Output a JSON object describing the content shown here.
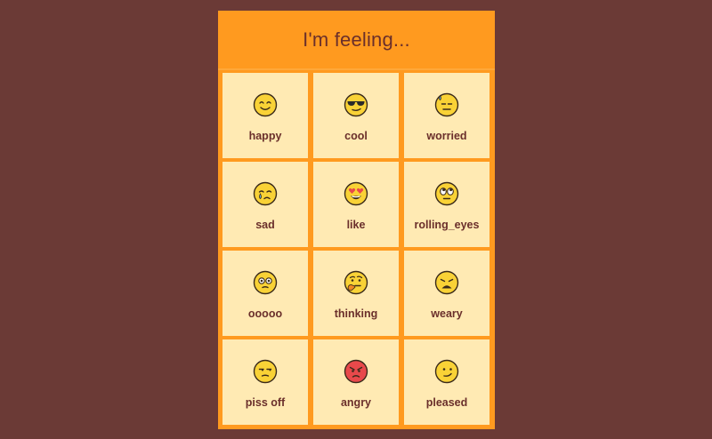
{
  "header": {
    "title": "I'm feeling..."
  },
  "moods": [
    {
      "label": "happy",
      "icon": "happy-face-icon"
    },
    {
      "label": "cool",
      "icon": "sunglasses-face-icon"
    },
    {
      "label": "worried",
      "icon": "sweat-face-icon"
    },
    {
      "label": "sad",
      "icon": "crying-face-icon"
    },
    {
      "label": "like",
      "icon": "heart-eyes-face-icon"
    },
    {
      "label": "rolling_eyes",
      "icon": "rolling-eyes-face-icon"
    },
    {
      "label": "ooooo",
      "icon": "dizzy-face-icon"
    },
    {
      "label": "thinking",
      "icon": "thinking-face-icon"
    },
    {
      "label": "weary",
      "icon": "weary-face-icon"
    },
    {
      "label": "piss off",
      "icon": "unamused-face-icon"
    },
    {
      "label": "angry",
      "icon": "angry-face-icon"
    },
    {
      "label": "pleased",
      "icon": "smirk-face-icon"
    }
  ],
  "colors": {
    "background": "#6b3a36",
    "panel": "#ff9a1f",
    "tile": "#ffeab3",
    "text": "#6a2f2b",
    "emoji_yellow": "#f9d236",
    "emoji_red": "#e8494b"
  }
}
